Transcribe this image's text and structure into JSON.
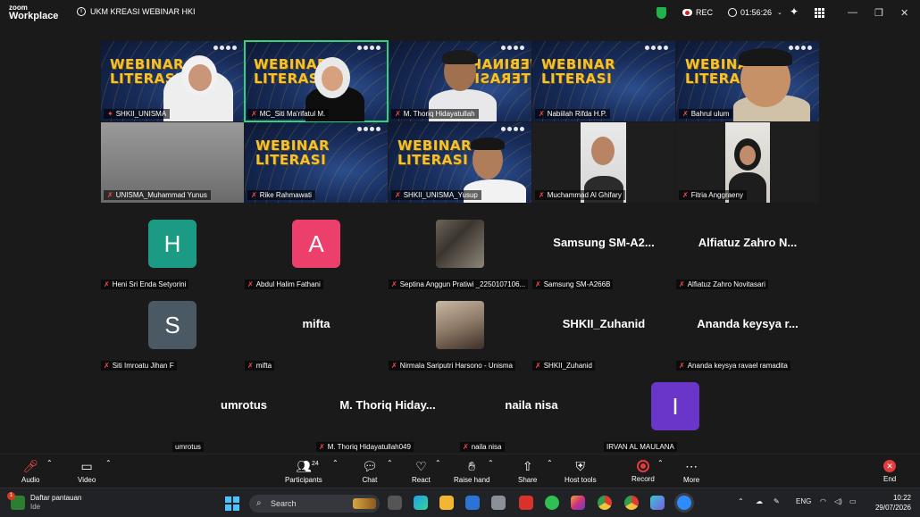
{
  "window": {
    "brand_top": "zoom",
    "brand_bottom": "Workplace",
    "meeting_title": "UKM KREASI WEBINAR HKI",
    "rec_label": "REC",
    "timer": "01:56:26"
  },
  "banner": {
    "title_line1": "WEBINAR",
    "title_line2": "LITERASI"
  },
  "video_tiles": [
    {
      "name": "SHKII_UNISMA"
    },
    {
      "name": "MC_Siti Ma'rifatul M."
    },
    {
      "name": "M. Thoriq Hidayatullah"
    },
    {
      "name": "Nabiilah Rifda H.P."
    },
    {
      "name": "Bahrul ulum"
    },
    {
      "name": "UNISMA_Muhammad Yunus"
    },
    {
      "name": "Rike Rahmawati"
    },
    {
      "name": "SHKII_UNISMA_Yusup"
    },
    {
      "name": "Muchammad Al Ghifary"
    },
    {
      "name": "Fitria Anggraeny"
    }
  ],
  "participant_tiles": [
    {
      "avatar": "H",
      "name": "Heni Sri Enda Setyorini",
      "color": "#1b9a84"
    },
    {
      "avatar": "A",
      "name": "Abdul Halim Fathani",
      "color": "#ec3f6c"
    },
    {
      "display": "",
      "name": "Septina Anggun Pratiwi _2250107106..."
    },
    {
      "display": "Samsung  SM-A2...",
      "name": "Samsung SM-A266B"
    },
    {
      "display": "Alfiatuz Zahro N...",
      "name": "Alfiatuz Zahro Novitasari"
    },
    {
      "avatar": "S",
      "name": "Siti Imroatu Jihan F",
      "color": "#4a5963"
    },
    {
      "display": "mifta",
      "name": "mifta"
    },
    {
      "display": "",
      "name": "Nirmala Sariputri Harsono - Unisma"
    },
    {
      "display": "SHKII_Zuhanid",
      "name": "SHKII_Zuhanid"
    },
    {
      "display": "Ananda keysya r...",
      "name": "Ananda keysya ravael ramadita"
    },
    {
      "display": "umrotus",
      "name": "umrotus"
    },
    {
      "display": "M. Thoriq Hiday...",
      "name": "M. Thoriq Hidayatullah049"
    },
    {
      "display": "naila nisa",
      "name": "naila nisa"
    },
    {
      "avatar": "I",
      "name": "IRVAN AL MAULANA",
      "color": "#6a35c9"
    }
  ],
  "toolbar": {
    "audio": "Audio",
    "video": "Video",
    "participants": "Participants",
    "participants_count": "24",
    "chat": "Chat",
    "react": "React",
    "raise_hand": "Raise hand",
    "share": "Share",
    "host_tools": "Host tools",
    "record": "Record",
    "more": "More",
    "end": "End"
  },
  "taskbar": {
    "widget_badge": "1",
    "widget_title": "Daftar pantauan",
    "widget_sub": "Ide",
    "search": "Search",
    "lang": "ENG",
    "time": "10:22",
    "date": "29/07/2026"
  }
}
